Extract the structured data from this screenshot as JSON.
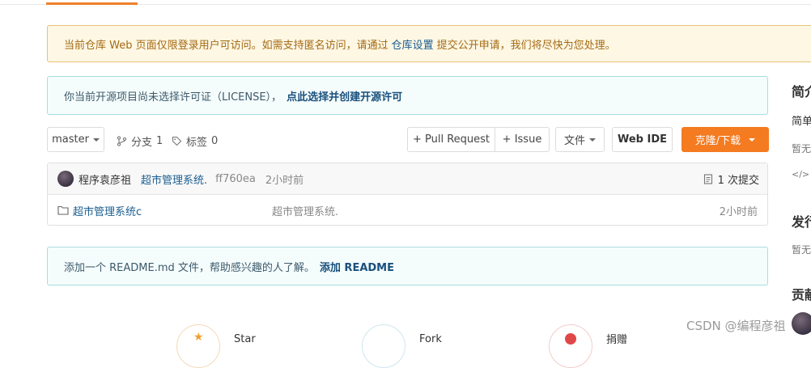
{
  "notice": {
    "text_before": "当前仓库 Web 页面仅限登录用户可访问。如需支持匿名访问，请通过",
    "link": "仓库设置",
    "text_after": "提交公开申请，我们将尽快为您处理。"
  },
  "license": {
    "text": "你当前开源项目尚未选择许可证（LICENSE），",
    "action": "点此选择并创建开源许可"
  },
  "toolbar": {
    "branch": "master",
    "branches_label": "分支",
    "branches_count": "1",
    "tags_label": "标签",
    "tags_count": "0",
    "pull_request": "+ Pull Request",
    "issue": "+ Issue",
    "file": "文件",
    "web_ide": "Web IDE",
    "clone": "克隆/下载"
  },
  "latest_commit": {
    "author": "程序袁彦祖",
    "message": "超市管理系统.",
    "hash": "ff760ea",
    "time": "2小时前",
    "commits_count": "1 次提交"
  },
  "files": [
    {
      "name": "超市管理系统c",
      "message": "超市管理系统.",
      "time": "2小时前"
    }
  ],
  "readme": {
    "text": "添加一个 README.md 文件，帮助感兴趣的人了解。",
    "action": "添加 README"
  },
  "sidebar": {
    "intro_title": "简介",
    "intro_text": "简单",
    "intro_empty": "暂无",
    "release_title": "发行",
    "release_empty": "暂无",
    "contrib_title": "贡献"
  },
  "bottom": {
    "star": "Star",
    "fork": "Fork",
    "donate": "捐赠"
  },
  "watermark": "CSDN @编程彦祖"
}
